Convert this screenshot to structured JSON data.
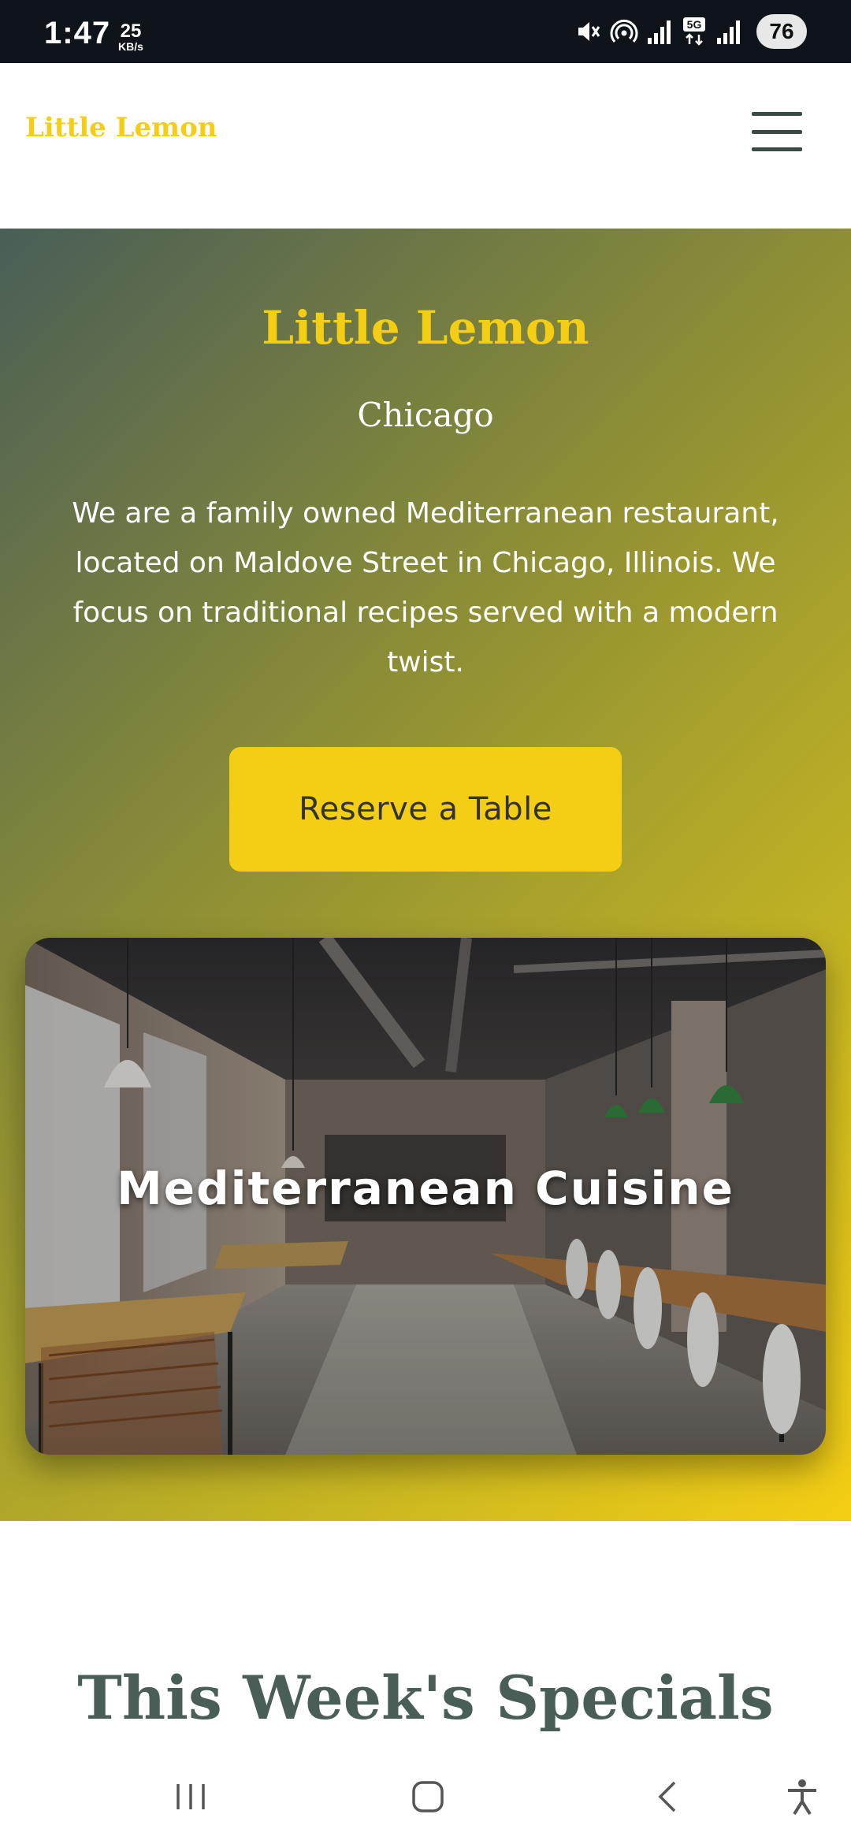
{
  "status_bar": {
    "time": "1:47",
    "net_speed_value": "25",
    "net_speed_unit": "KB/s",
    "battery": "76",
    "icons": [
      "mute-icon",
      "hotspot-icon",
      "signal-icon",
      "5g-icon",
      "signal-icon"
    ]
  },
  "header": {
    "brand": "Little Lemon",
    "menu_icon": "hamburger-icon"
  },
  "hero": {
    "title": "Little Lemon",
    "subtitle": "Chicago",
    "description": "We are a family owned Mediterranean restaurant, located on Maldove Street in Chicago, Illinois. We focus on traditional recipes served with a modern twist.",
    "cta_label": "Reserve a Table",
    "image_caption": "Mediterranean Cuisine"
  },
  "specials": {
    "title": "This Week's Specials"
  },
  "nav_bar": {
    "icons": [
      "recents-icon",
      "home-icon",
      "back-icon",
      "accessibility-icon"
    ]
  },
  "colors": {
    "brand_yellow": "#f4ce14",
    "brand_green": "#495e57",
    "status_bar_bg": "#0f131a"
  }
}
